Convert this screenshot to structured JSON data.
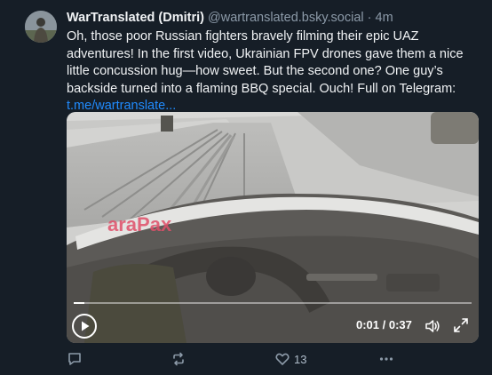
{
  "post": {
    "author_name": "WarTranslated (Dmitri)",
    "author_handle": "@wartranslated.bsky.social",
    "separator": " · ",
    "time": "4m",
    "text": "Oh, those poor Russian fighters bravely filming their epic UAZ adventures! In the first video, Ukrainian FPV drones gave them a nice little concussion hug—how sweet. But the second one? One guy’s backside turned into a flaming BBQ special. Ouch! Full on Telegram:",
    "link": "t.me/wartranslate..."
  },
  "video": {
    "watermark": "araPax",
    "current_time": "0:01",
    "duration": "0:37",
    "time_display": "0:01 / 0:37",
    "progress_fraction": 0.027
  },
  "actions": {
    "like_count": "13",
    "icons": [
      "reply-icon",
      "repost-icon",
      "like-icon",
      "more-icon"
    ]
  },
  "colors": {
    "background": "#161e27",
    "link": "#208bfe",
    "muted": "#8c9aa8"
  }
}
